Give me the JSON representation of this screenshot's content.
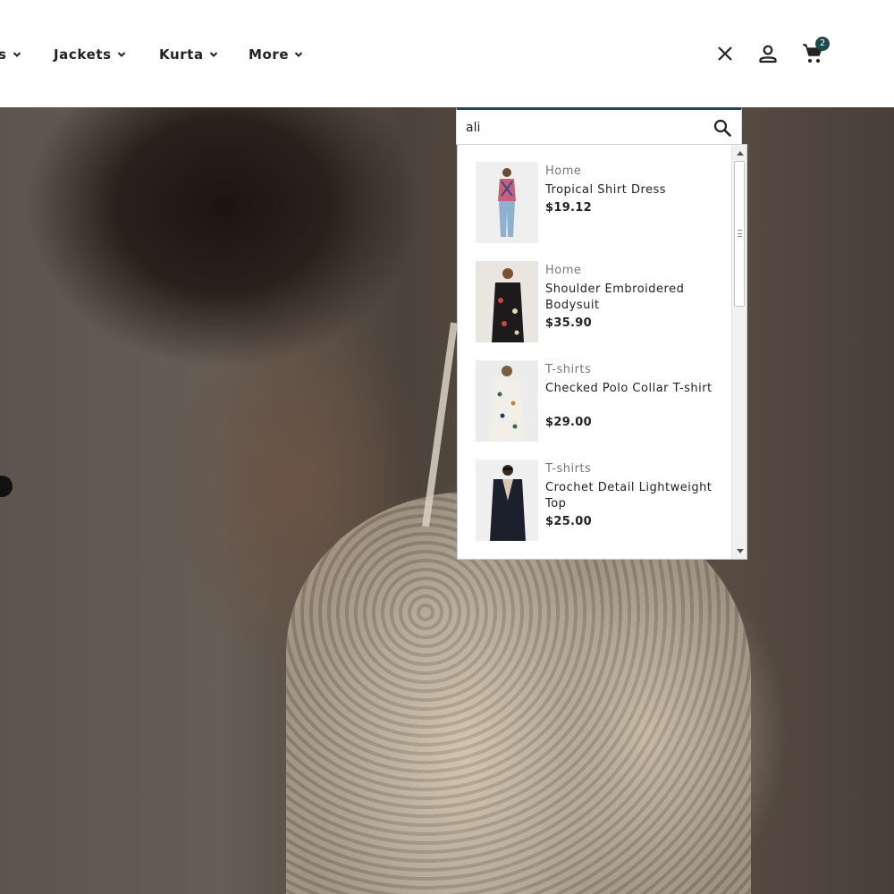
{
  "nav": {
    "items": [
      {
        "label": "s"
      },
      {
        "label": "Jackets"
      },
      {
        "label": "Kurta"
      },
      {
        "label": "More"
      }
    ]
  },
  "header_icons": {
    "close": "close-icon",
    "account": "user-icon",
    "cart": "cart-icon",
    "cart_count": "2"
  },
  "search": {
    "value": "ali",
    "icon": "search-icon"
  },
  "results": [
    {
      "category": "Home",
      "name": "Tropical Shirt Dress",
      "price": "$19.12"
    },
    {
      "category": "Home",
      "name": "Shoulder Embroidered Bodysuit",
      "price": "$35.90"
    },
    {
      "category": "T-shirts",
      "name": "Checked Polo Collar T-shirt",
      "price": "$29.00"
    },
    {
      "category": "T-shirts",
      "name": "Crochet Detail Lightweight Top",
      "price": "$25.00"
    }
  ],
  "colors": {
    "accent": "#1f4a4c",
    "text": "#222222",
    "muted": "#777777"
  }
}
